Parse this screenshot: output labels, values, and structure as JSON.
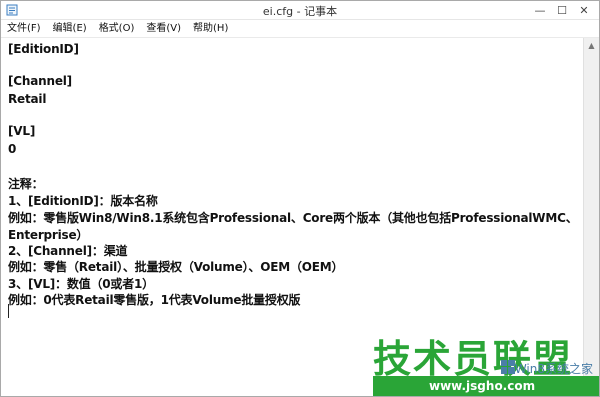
{
  "window": {
    "title": "ei.cfg - 记事本"
  },
  "menu": {
    "items": [
      "文件(F)",
      "编辑(E)",
      "格式(O)",
      "查看(V)",
      "帮助(H)"
    ]
  },
  "editor": {
    "lines": [
      "[EditionID]",
      "",
      "[Channel]",
      "Retail",
      "",
      "[VL]",
      "0",
      "",
      "注释：",
      "1、[EditionID]：版本名称",
      "例如：零售版Win8/Win8.1系统包含Professional、Core两个版本（其他也包括ProfessionalWMC、",
      "Enterprise）",
      "2、[Channel]：渠道",
      "例如：零售（Retail）、批量授权（Volume）、OEM（OEM）",
      "3、[VL]：数值（0或者1）",
      "例如：0代表Retail零售版，1代表Volume批量授权版"
    ]
  },
  "watermark": {
    "brand": "技术员联盟",
    "site": "www.jsgho.com",
    "win8": "Win8系统之家"
  },
  "colors": {
    "watermark_green": "#2aa537"
  },
  "icons": {
    "app": "notepad-icon",
    "minimize": "minimize-icon",
    "maximize": "maximize-icon",
    "close": "close-icon"
  }
}
